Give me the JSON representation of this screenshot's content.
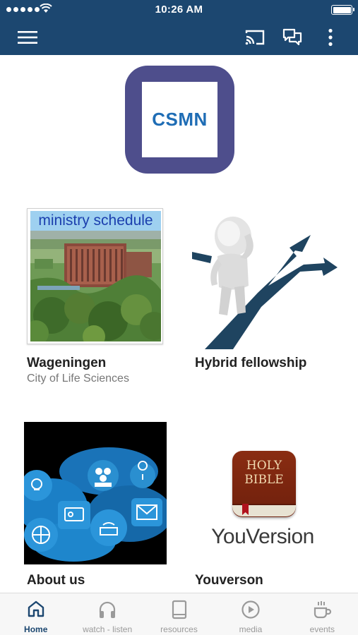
{
  "status_bar": {
    "time": "10:26 AM"
  },
  "app_bar": {
    "color": "#1c4770",
    "icons": [
      "menu-icon",
      "cast-icon",
      "chat-icon",
      "more-vert-icon"
    ]
  },
  "logo": {
    "text": "CSMN",
    "frame_color": "#4e4e8c",
    "text_color": "#1f6db5"
  },
  "cards": [
    {
      "title": "Wageningen",
      "subtitle": "City of Life Sciences",
      "overlay_text": "ministry schedule"
    },
    {
      "title": "Hybrid fellowship",
      "subtitle": ""
    },
    {
      "title": "About us",
      "subtitle": ""
    },
    {
      "title": "Youverson",
      "subtitle": "",
      "image_title": "HOLY BIBLE",
      "image_brand": "YouVersion"
    }
  ],
  "tabs": [
    {
      "label": "Home",
      "icon": "home-icon",
      "active": true
    },
    {
      "label": "watch - listen",
      "icon": "headphones-icon",
      "active": false
    },
    {
      "label": "resources",
      "icon": "book-icon",
      "active": false
    },
    {
      "label": "media",
      "icon": "play-circle-icon",
      "active": false
    },
    {
      "label": "events",
      "icon": "coffee-icon",
      "active": false
    }
  ]
}
